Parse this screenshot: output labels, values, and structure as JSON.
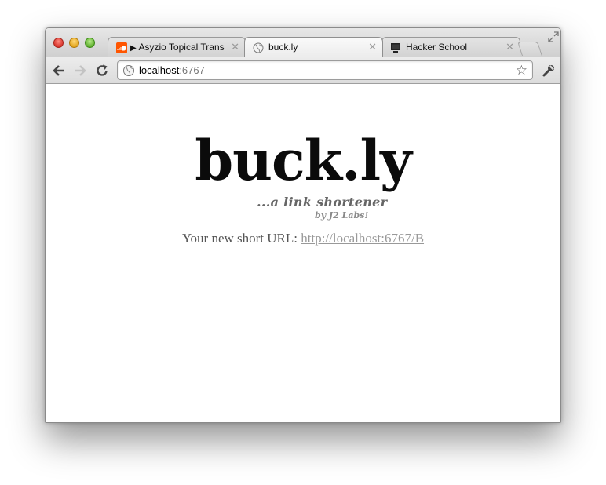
{
  "browser": {
    "tabs": [
      {
        "title": "Asyzio Topical Trans",
        "active": false,
        "icon": "soundcloud-icon"
      },
      {
        "title": "buck.ly",
        "active": true,
        "icon": "globe-icon"
      },
      {
        "title": "Hacker School",
        "active": false,
        "icon": "computer-icon"
      }
    ],
    "tab_close_glyph": "✕",
    "url_host": "localhost",
    "url_port": ":6767",
    "bookmark_glyph": "☆"
  },
  "page": {
    "logo": "buck.ly",
    "tagline": "...a link shortener",
    "byline": "by J2 Labs!",
    "short_url_label": "Your new short URL: ",
    "short_url": "http://localhost:6767/B"
  },
  "colors": {
    "soundcloud_orange": "#ff5500",
    "link_gray": "#999999"
  }
}
